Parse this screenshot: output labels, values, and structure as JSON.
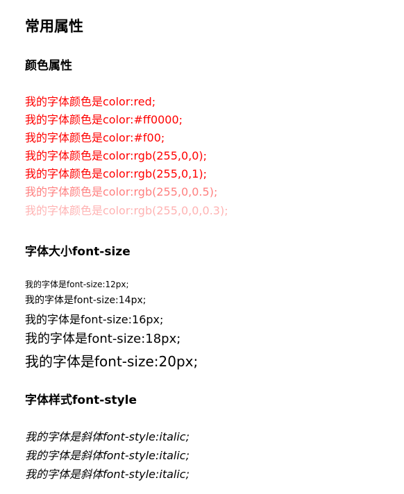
{
  "page_title": "常用属性",
  "color_section": {
    "heading": "颜色属性",
    "lines": [
      {
        "text": "我的字体颜色是color:red;",
        "color": "#ff0000"
      },
      {
        "text": "我的字体颜色是color:#ff0000;",
        "color": "#ff0000"
      },
      {
        "text": "我的字体颜色是color:#f00;",
        "color": "#ff0000"
      },
      {
        "text": "我的字体颜色是color:rgb(255,0,0);",
        "color": "#ff0000"
      },
      {
        "text": "我的字体颜色是color:rgb(255,0,1);",
        "color": "#ff0001"
      },
      {
        "text": "我的字体颜色是color:rgb(255,0,0.5);",
        "color": "rgba(255,0,0,0.5)"
      },
      {
        "text": "我的字体颜色是color:rgb(255,0,0,0.3);",
        "color": "rgba(255,0,0,0.3)"
      }
    ]
  },
  "size_section": {
    "heading": "字体大小font-size",
    "lines": [
      {
        "text": "我的字体是font-size:12px;"
      },
      {
        "text": "我的字体是font-size:14px;"
      },
      {
        "text": "我的字体是font-size:16px;"
      },
      {
        "text": "我的字体是font-size:18px;"
      },
      {
        "text": "我的字体是font-size:20px;"
      }
    ]
  },
  "style_section": {
    "heading": "字体样式font-style",
    "lines": [
      {
        "text": "我的字体是斜体font-style:italic;"
      },
      {
        "text": "我的字体是斜体font-style:italic;"
      },
      {
        "text": "我的字体是斜体font-style:italic;"
      }
    ]
  }
}
